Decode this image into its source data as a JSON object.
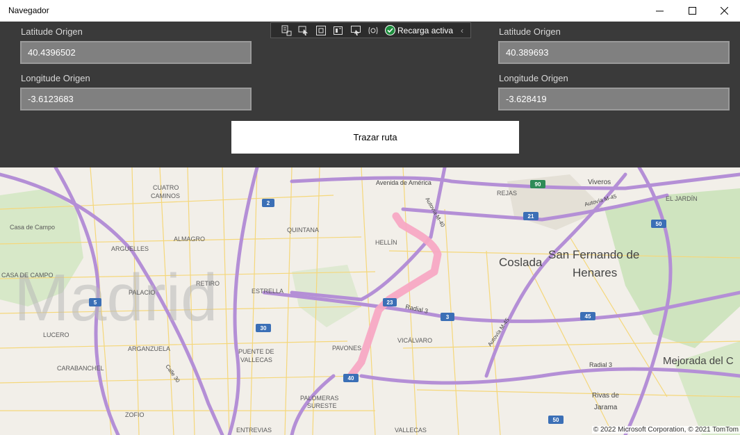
{
  "window": {
    "title": "Navegador"
  },
  "devtools": {
    "status_label": "Recarga activa",
    "tools": [
      "live-visual-tree-icon",
      "select-element-icon",
      "display-layout-adorners-icon",
      "track-focus-icon",
      "preview-selection-icon",
      "binding-failures-icon"
    ]
  },
  "form": {
    "left": {
      "lat_label": "Latitude Origen",
      "lat_value": "40.4396502",
      "lon_label": "Longitude Origen",
      "lon_value": "-3.6123683"
    },
    "right": {
      "lat_label": "Latitude Origen",
      "lat_value": "40.389693",
      "lon_label": "Longitude Origen",
      "lon_value": "-3.628419"
    },
    "route_button": "Trazar ruta"
  },
  "map": {
    "copyright": "© 2022 Microsoft Corporation, © 2021 TomTom",
    "watermark": "Madrid",
    "places": [
      {
        "name": "CUATRO",
        "id": "cuatro"
      },
      {
        "name": "CAMINOS",
        "id": "caminos"
      },
      {
        "name": "Casa de Campo",
        "id": "casa-de-campo"
      },
      {
        "name": "ARGUELLES",
        "id": "arguelles"
      },
      {
        "name": "ALMAGRO",
        "id": "almagro"
      },
      {
        "name": "CASA DE CAMPO",
        "id": "casa-de-campo-district"
      },
      {
        "name": "RETIRO",
        "id": "retiro"
      },
      {
        "name": "PALACIO",
        "id": "palacio"
      },
      {
        "name": "ESTRELLA",
        "id": "estrella"
      },
      {
        "name": "LUCERO",
        "id": "lucero"
      },
      {
        "name": "ARGANZUELA",
        "id": "arganzuela"
      },
      {
        "name": "PUENTE DE",
        "id": "puente-de"
      },
      {
        "name": "VALLECAS",
        "id": "vallecas-puente"
      },
      {
        "name": "CARABANCHEL",
        "id": "carabanchel"
      },
      {
        "name": "ZOFIO",
        "id": "zofio"
      },
      {
        "name": "PALOMERAS",
        "id": "palomeras"
      },
      {
        "name": "SURESTE",
        "id": "sureste"
      },
      {
        "name": "ENTREVIAS",
        "id": "entrevias"
      },
      {
        "name": "VALLECAS",
        "id": "vallecas"
      },
      {
        "name": "PAVONES",
        "id": "pavones"
      },
      {
        "name": "VICÁLVARO",
        "id": "vicalvaro"
      },
      {
        "name": "QUINTANA",
        "id": "quintana"
      },
      {
        "name": "HELLÍN",
        "id": "hellin"
      },
      {
        "name": "Avenida de América",
        "id": "avenida-de-america"
      },
      {
        "name": "REJAS",
        "id": "rejas"
      },
      {
        "name": "Viveros",
        "id": "viveros"
      },
      {
        "name": "EL JARDÍN",
        "id": "el-jardin"
      },
      {
        "name": "Coslada",
        "id": "coslada"
      },
      {
        "name": "San Fernando de",
        "id": "san-fernando-1"
      },
      {
        "name": "Henares",
        "id": "san-fernando-2"
      },
      {
        "name": "Mejorada del C",
        "id": "mejorada"
      },
      {
        "name": "Rivas de",
        "id": "rivas-1"
      },
      {
        "name": "Jarama",
        "id": "rivas-2"
      },
      {
        "name": "Radial 3",
        "id": "radial-3-a"
      },
      {
        "name": "Radial 3",
        "id": "radial-3-b"
      },
      {
        "name": "Autovía M-40",
        "id": "autovia-m40"
      },
      {
        "name": "Autovía M-45",
        "id": "autovia-m45"
      },
      {
        "name": "Autovía M-45",
        "id": "autovia-m45-b"
      },
      {
        "name": "Calle 30",
        "id": "calle-30"
      }
    ],
    "shields": [
      "2",
      "5",
      "30",
      "23",
      "3",
      "40",
      "90",
      "21",
      "45",
      "50",
      "50"
    ]
  },
  "colors": {
    "panel_bg": "#3a3a3a",
    "field_bg": "#808080",
    "route": "#f7a8c4",
    "highway": "#b48fd6",
    "shield": "#3b6fb6"
  }
}
